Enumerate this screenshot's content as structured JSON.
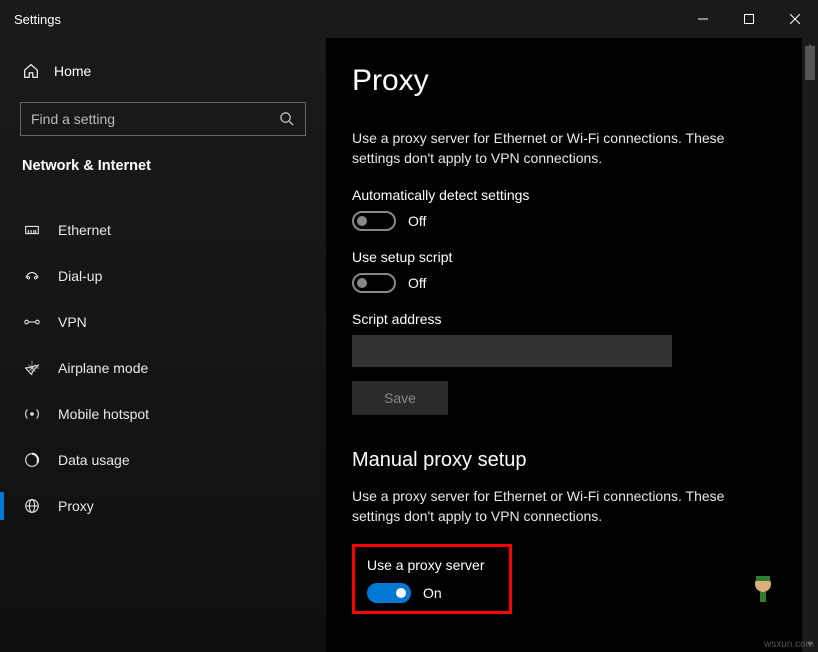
{
  "window": {
    "title": "Settings"
  },
  "sidebar": {
    "home": "Home",
    "search_placeholder": "Find a setting",
    "category": "Network & Internet",
    "items": [
      {
        "label": "Ethernet",
        "icon": "ethernet"
      },
      {
        "label": "Dial-up",
        "icon": "dialup"
      },
      {
        "label": "VPN",
        "icon": "vpn"
      },
      {
        "label": "Airplane mode",
        "icon": "airplane"
      },
      {
        "label": "Mobile hotspot",
        "icon": "hotspot"
      },
      {
        "label": "Data usage",
        "icon": "datausage"
      },
      {
        "label": "Proxy",
        "icon": "globe",
        "active": true
      }
    ]
  },
  "page": {
    "title": "Proxy",
    "auto": {
      "description": "Use a proxy server for Ethernet or Wi-Fi connections. These settings don't apply to VPN connections.",
      "detect_label": "Automatically detect settings",
      "detect_state": "Off",
      "script_label": "Use setup script",
      "script_state": "Off",
      "script_address_label": "Script address",
      "script_address_value": "",
      "save_button": "Save"
    },
    "manual": {
      "heading": "Manual proxy setup",
      "description": "Use a proxy server for Ethernet or Wi-Fi connections. These settings don't apply to VPN connections.",
      "use_proxy_label": "Use a proxy server",
      "use_proxy_state": "On"
    }
  },
  "watermark": "wsxun.com"
}
